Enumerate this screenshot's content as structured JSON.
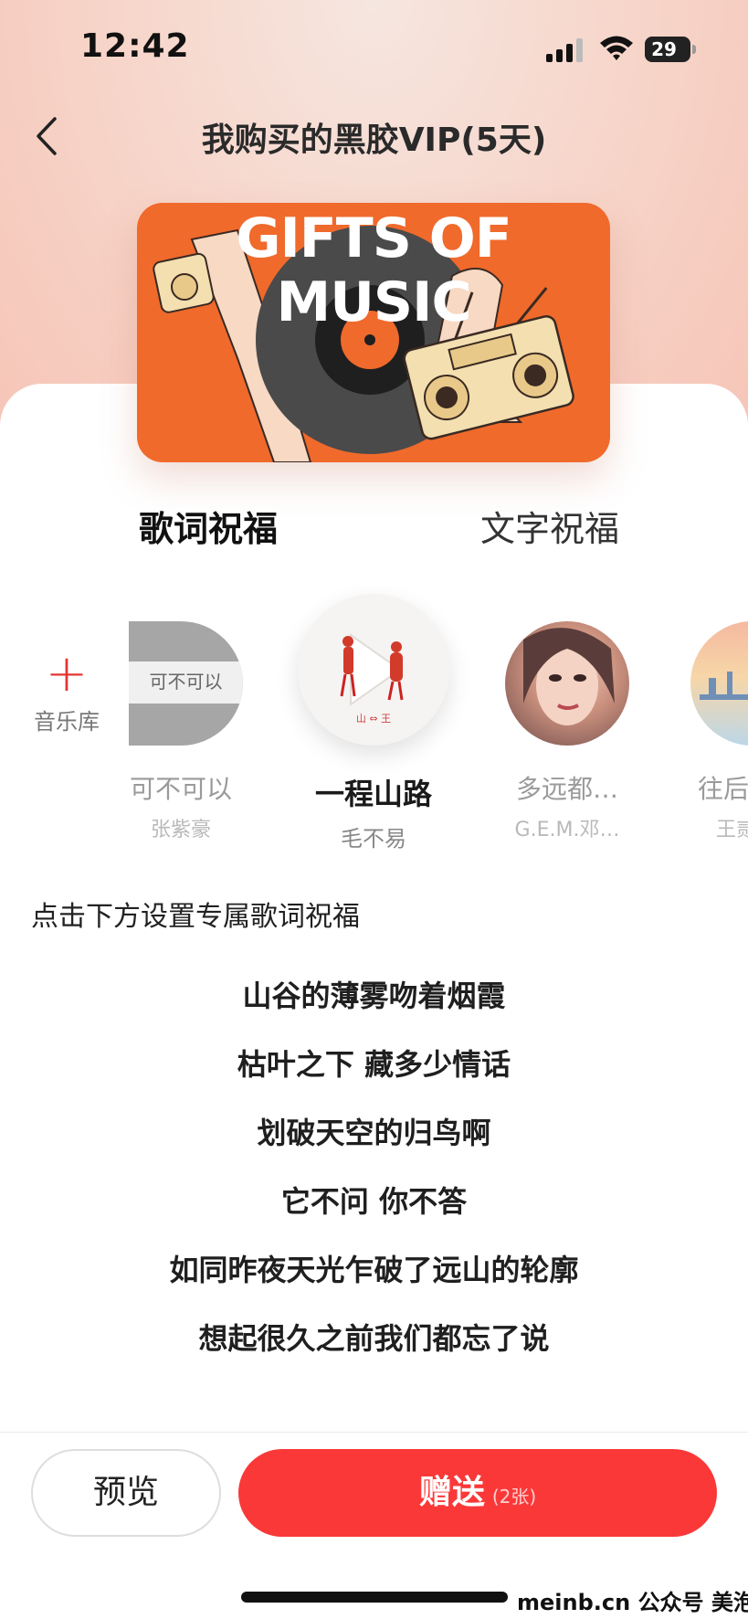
{
  "status_bar": {
    "time": "12:42",
    "battery": "29"
  },
  "nav": {
    "title": "我购买的黑胶VIP(5天)"
  },
  "banner": {
    "text": "GIFTS OF MUSIC"
  },
  "tabs": [
    {
      "label": "歌词祝福",
      "active": true
    },
    {
      "label": "文字祝福",
      "active": false
    }
  ],
  "music_library": {
    "label": "音乐库"
  },
  "songs": [
    {
      "name": "可不可以",
      "artist": "张紫豪",
      "cover_text": "可不可以"
    },
    {
      "name": "一程山路",
      "artist": "毛不易",
      "cover_text": "山 ⇔ 王"
    },
    {
      "name": "多远都…",
      "artist": "G.E.M.邓…"
    },
    {
      "name": "往后",
      "artist": "王贰"
    }
  ],
  "prompt": "点击下方设置专属歌词祝福",
  "lyrics": [
    "山谷的薄雾吻着烟霞",
    "枯叶之下 藏多少情话",
    "划破天空的归鸟啊",
    "它不问 你不答",
    "如同昨夜天光乍破了远山的轮廓",
    "想起很久之前我们都忘了说"
  ],
  "actions": {
    "preview": "预览",
    "send": "赠送",
    "send_count": "(2张)"
  },
  "watermark": "meinb.cn 公众号 美泡君",
  "colors": {
    "accent": "#fa3838",
    "banner": "#f06a2c",
    "tab_underline": "#ea3f45"
  }
}
